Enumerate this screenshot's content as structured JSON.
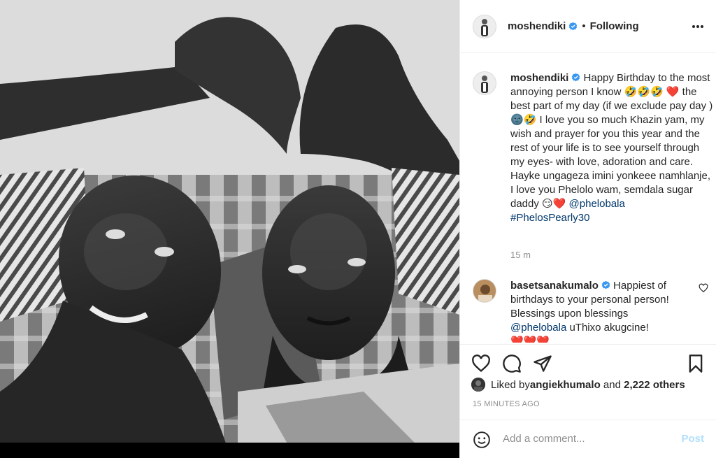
{
  "post": {
    "photo_alt": "selfie",
    "author": "moshendiki",
    "following_label": "Following",
    "separator": "•",
    "more_icon": "more-horizontal-icon",
    "verified_icon": "verified-badge-icon"
  },
  "caption": {
    "username": "moshendiki",
    "text_1": " Happy Birthday to the most annoying person I know 🤣🤣🤣 ❤️ the best part of my day (if we exclude pay day ) 🌚🤣 I love you so much Khazin yam, my wish and prayer for you this year and the rest of your life is to see yourself through my eyes- with love, adoration and care. Hayke ungageza imini yonkeee namhlanje, I love you Phelolo wam, semdala sugar daddy 😏❤️ ",
    "mention": "@phelobala",
    "hashtag": "#PhelosPearly30",
    "time": "15 m"
  },
  "comment": {
    "username": "basetsanakumalo",
    "text": " Happiest of birthdays to your personal person! Blessings upon blessings ",
    "mention": "@phelobala",
    "text_2": " uThixo akugcine!",
    "emoji": "❤️❤️❤️"
  },
  "likes": {
    "prefix": "Liked by ",
    "user": "angiekhumalo",
    "and": " and ",
    "others": "2,222 others"
  },
  "timestamp": "15 MINUTES AGO",
  "add_comment": {
    "placeholder": "Add a comment...",
    "post_label": "Post"
  },
  "colors": {
    "link": "#00376b",
    "verified": "#3897f0",
    "post_disabled": "#b2dffc",
    "heart": "#ed4956"
  }
}
